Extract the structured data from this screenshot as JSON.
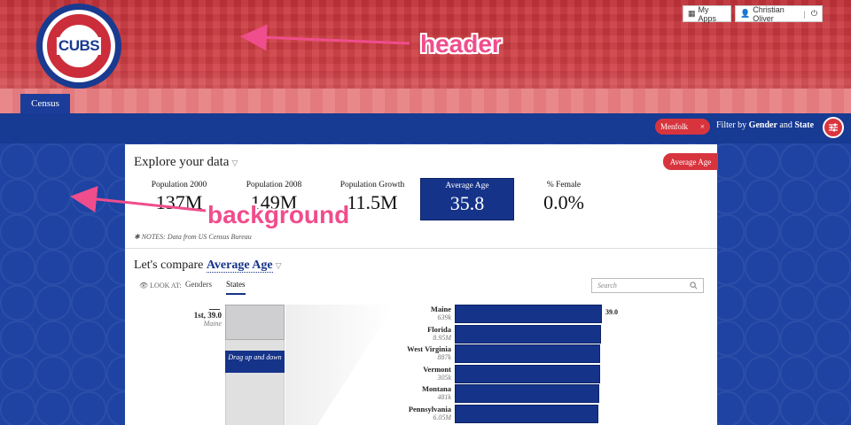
{
  "header": {
    "logo_text": "CUBS",
    "my_apps": "My Apps",
    "user_name": "Christian Oliver",
    "separator": "|",
    "nav_tab": "Census"
  },
  "annotations": {
    "header": "header",
    "background": "background"
  },
  "filter": {
    "chip_label": "Menfolk",
    "chip_close": "×",
    "label_prefix": "Filter by",
    "label_gender": "Gender",
    "label_and": "and",
    "label_state": "State"
  },
  "explore": {
    "title": "Explore your data",
    "tag": "Average Age",
    "stats": [
      {
        "label": "Population 2000",
        "value": "137M"
      },
      {
        "label": "Population 2008",
        "value": "149M"
      },
      {
        "label": "Population Growth",
        "value": "11.5M"
      },
      {
        "label": "Average Age",
        "value": "35.8"
      },
      {
        "label": "% Female",
        "value": "0.0%"
      }
    ],
    "notes": "✱ NOTES: Data from US Census Bureau"
  },
  "compare": {
    "title": "Let's compare",
    "metric": "Average Age",
    "look_at": "👁 LOOK AT:",
    "tabs": [
      "Genders",
      "States"
    ],
    "search_placeholder": "Search",
    "rank_label": "1st, 39.0",
    "rank_state": "Maine",
    "drag_tip": "Drag up and down",
    "rows": [
      {
        "state": "Maine",
        "pop": "639k",
        "value": 39.0,
        "label": "39.0"
      },
      {
        "state": "Florida",
        "pop": "8.95M",
        "value": 38.8
      },
      {
        "state": "West Virginia",
        "pop": "887k",
        "value": 38.7
      },
      {
        "state": "Vermont",
        "pop": "305k",
        "value": 38.7
      },
      {
        "state": "Montana",
        "pop": "481k",
        "value": 38.5
      },
      {
        "state": "Pennsylvania",
        "pop": "6.05M",
        "value": 38.4
      }
    ]
  },
  "colors": {
    "accent_red": "#d8343e",
    "navy": "#16338a"
  }
}
